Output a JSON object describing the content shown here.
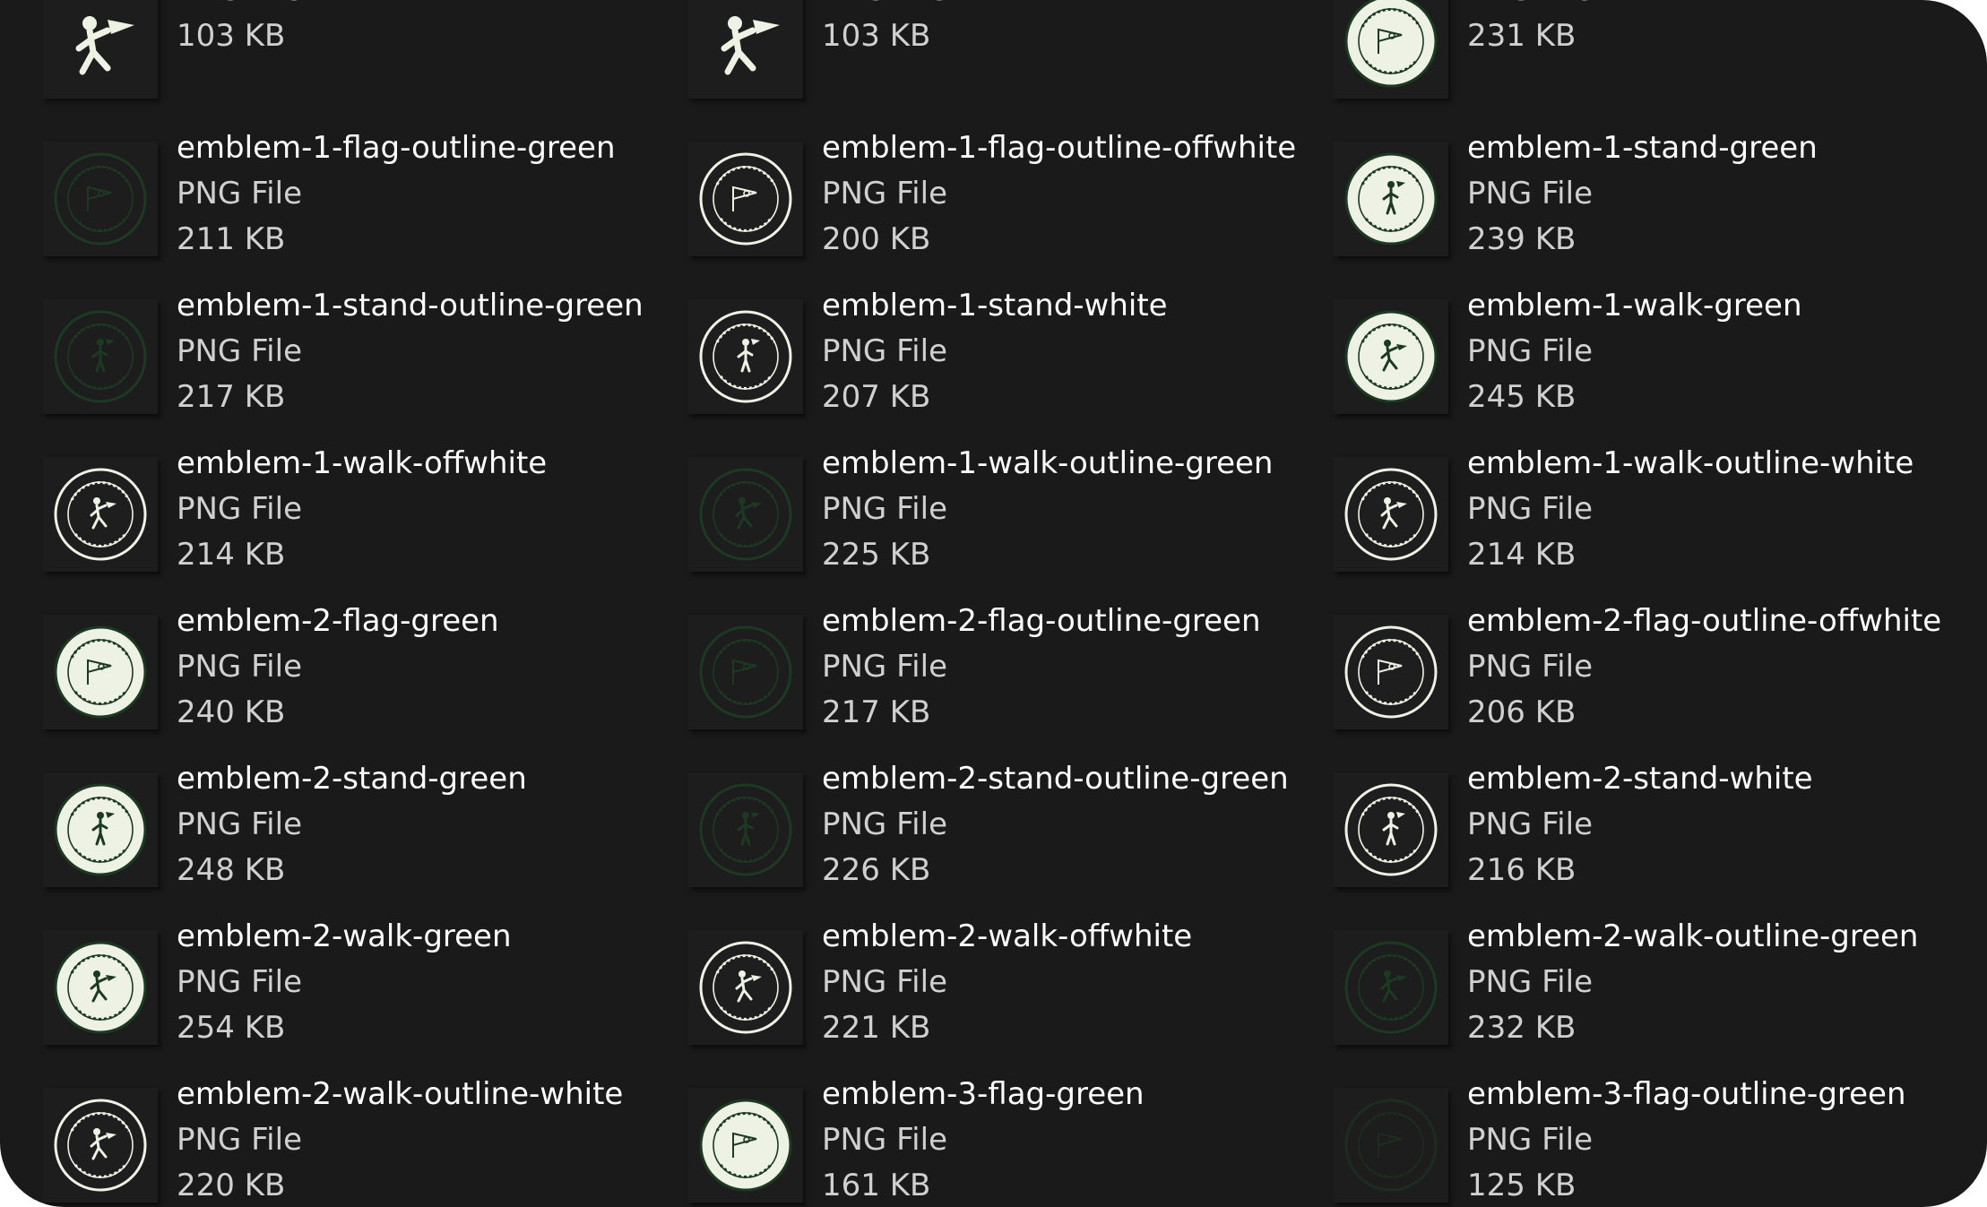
{
  "colors": {
    "background": "#1a1a1a",
    "text_primary": "#ffffff",
    "text_secondary": "#d0d0d0",
    "emblem_green": "#1c3a22",
    "emblem_offwhite": "#eef2e4",
    "emblem_dark": "#1e1e1e"
  },
  "files": [
    {
      "name": "",
      "type": "PNG File",
      "size": "103 KB",
      "icon": "walking-golfer-icon",
      "style": "figure"
    },
    {
      "name": "",
      "type": "PNG File",
      "size": "103 KB",
      "icon": "walking-golfer-icon",
      "style": "figure"
    },
    {
      "name": "",
      "type": "PNG File",
      "size": "231 KB",
      "icon": "flag-emblem-icon",
      "style": "light"
    },
    {
      "name": "emblem-1-flag-outline-green",
      "type": "PNG File",
      "size": "211 KB",
      "icon": "flag-emblem-icon",
      "style": "outline-green"
    },
    {
      "name": "emblem-1-flag-outline-offwhite",
      "type": "PNG File",
      "size": "200 KB",
      "icon": "flag-emblem-icon",
      "style": "outline-light"
    },
    {
      "name": "emblem-1-stand-green",
      "type": "PNG File",
      "size": "239 KB",
      "icon": "standing-golfer-emblem-icon",
      "style": "light"
    },
    {
      "name": "emblem-1-stand-outline-green",
      "type": "PNG File",
      "size": "217 KB",
      "icon": "standing-golfer-emblem-icon",
      "style": "outline-green"
    },
    {
      "name": "emblem-1-stand-white",
      "type": "PNG File",
      "size": "207 KB",
      "icon": "standing-golfer-emblem-icon",
      "style": "outline-light"
    },
    {
      "name": "emblem-1-walk-green",
      "type": "PNG File",
      "size": "245 KB",
      "icon": "walking-golfer-emblem-icon",
      "style": "light"
    },
    {
      "name": "emblem-1-walk-offwhite",
      "type": "PNG File",
      "size": "214 KB",
      "icon": "walking-golfer-emblem-icon",
      "style": "outline-light"
    },
    {
      "name": "emblem-1-walk-outline-green",
      "type": "PNG File",
      "size": "225 KB",
      "icon": "walking-golfer-emblem-icon",
      "style": "outline-green"
    },
    {
      "name": "emblem-1-walk-outline-white",
      "type": "PNG File",
      "size": "214 KB",
      "icon": "walking-golfer-emblem-icon",
      "style": "outline-light"
    },
    {
      "name": "emblem-2-flag-green",
      "type": "PNG File",
      "size": "240 KB",
      "icon": "flag-emblem-icon",
      "style": "light"
    },
    {
      "name": "emblem-2-flag-outline-green",
      "type": "PNG File",
      "size": "217 KB",
      "icon": "flag-emblem-icon",
      "style": "outline-green"
    },
    {
      "name": "emblem-2-flag-outline-offwhite",
      "type": "PNG File",
      "size": "206 KB",
      "icon": "flag-emblem-icon",
      "style": "outline-light"
    },
    {
      "name": "emblem-2-stand-green",
      "type": "PNG File",
      "size": "248 KB",
      "icon": "standing-golfer-emblem-icon",
      "style": "light"
    },
    {
      "name": "emblem-2-stand-outline-green",
      "type": "PNG File",
      "size": "226 KB",
      "icon": "standing-golfer-emblem-icon",
      "style": "outline-green"
    },
    {
      "name": "emblem-2-stand-white",
      "type": "PNG File",
      "size": "216 KB",
      "icon": "standing-golfer-emblem-icon",
      "style": "outline-light"
    },
    {
      "name": "emblem-2-walk-green",
      "type": "PNG File",
      "size": "254 KB",
      "icon": "walking-golfer-emblem-icon",
      "style": "light"
    },
    {
      "name": "emblem-2-walk-offwhite",
      "type": "PNG File",
      "size": "221 KB",
      "icon": "walking-golfer-emblem-icon",
      "style": "outline-light"
    },
    {
      "name": "emblem-2-walk-outline-green",
      "type": "PNG File",
      "size": "232 KB",
      "icon": "walking-golfer-emblem-icon",
      "style": "outline-green"
    },
    {
      "name": "emblem-2-walk-outline-white",
      "type": "PNG File",
      "size": "220 KB",
      "icon": "walking-golfer-emblem-icon",
      "style": "outline-light"
    },
    {
      "name": "emblem-3-flag-green",
      "type": "PNG File",
      "size": "161 KB",
      "icon": "flag-emblem-icon",
      "style": "solid-light"
    },
    {
      "name": "emblem-3-flag-outline-green",
      "type": "PNG File",
      "size": "125 KB",
      "icon": "flag-emblem-icon",
      "style": "outline-green-faint"
    }
  ]
}
